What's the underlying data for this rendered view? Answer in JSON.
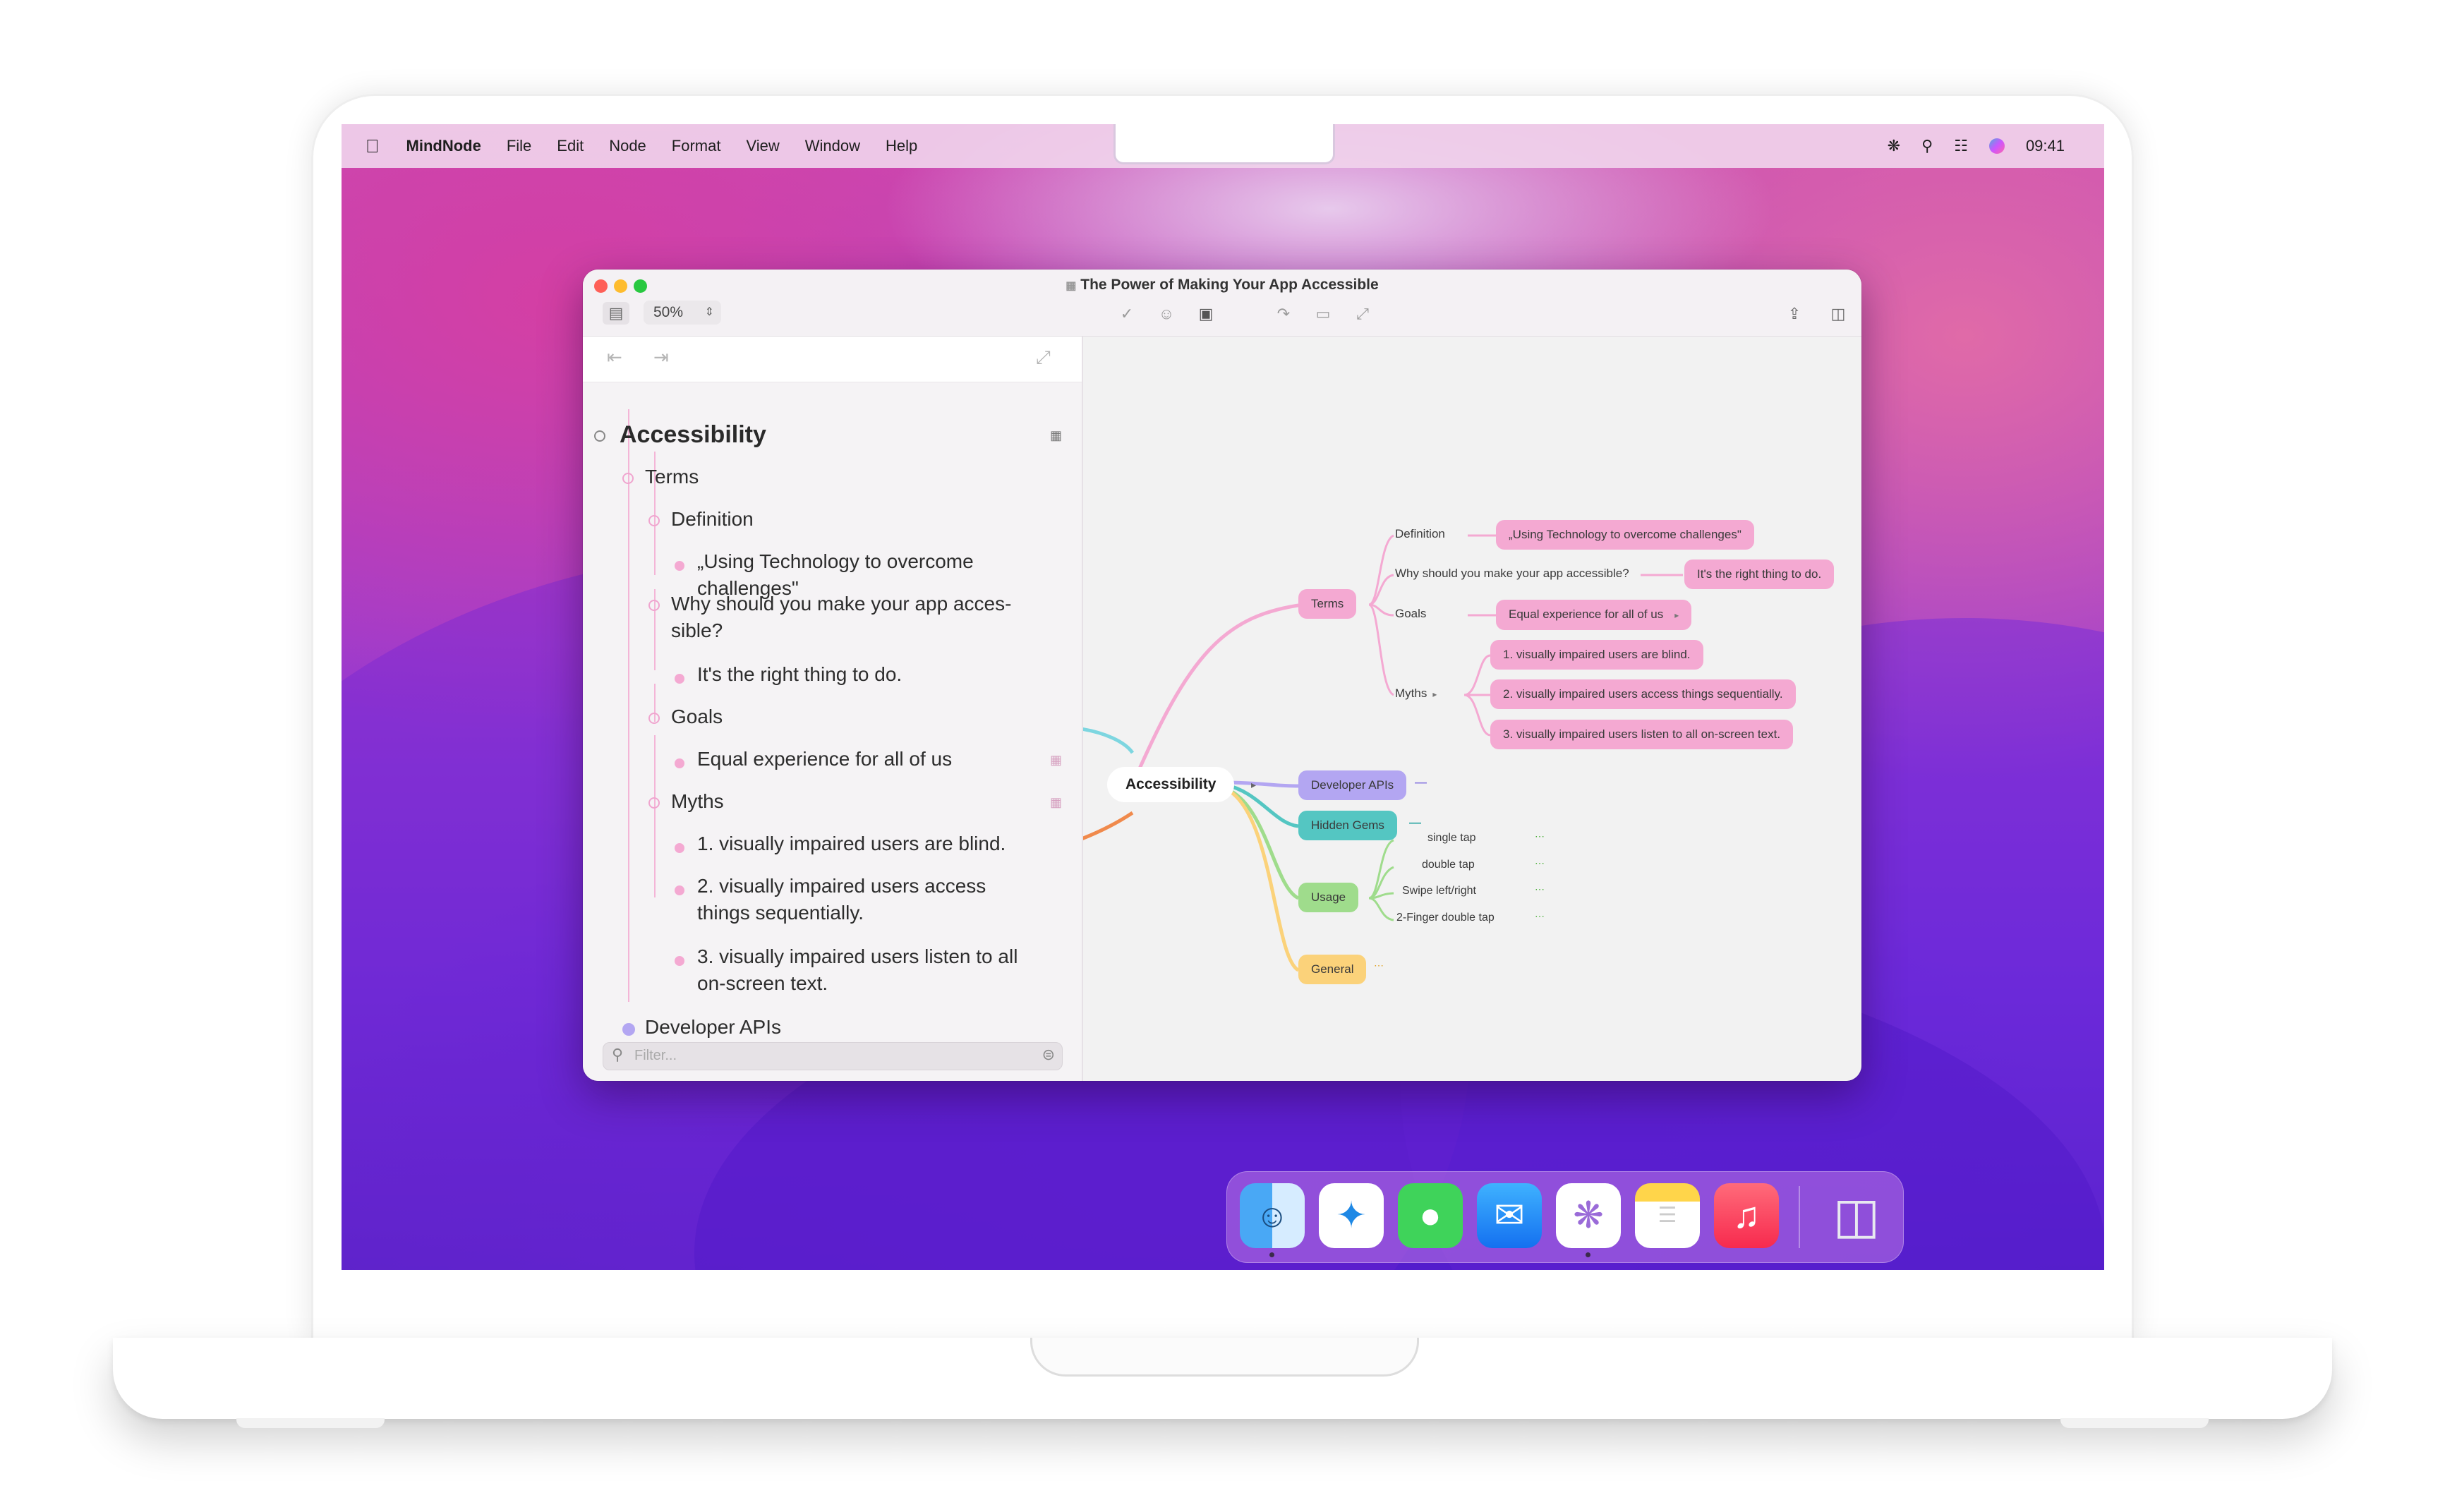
{
  "menubar": {
    "app_name": "MindNode",
    "menus": [
      "File",
      "Edit",
      "Node",
      "Format",
      "View",
      "Window",
      "Help"
    ],
    "clock": "09:41"
  },
  "window": {
    "title": "The Power of Making Your App Accessible",
    "zoom": "50%"
  },
  "outline": {
    "root": "Accessibility",
    "terms": "Terms",
    "definition": "Definition",
    "definition_value_1": "„Using Technology to overcome",
    "definition_value_2": "challenges\"",
    "why_1": "Why should you make your app acces-",
    "why_2": "sible?",
    "why_value": "It's the right thing to do.",
    "goals": "Goals",
    "goals_value": "Equal experience for all of us",
    "myths": "Myths",
    "myth_1": "1. visually impaired users are blind.",
    "myth_2_a": "2. visually impaired users access",
    "myth_2_b": "things sequentially.",
    "myth_3_a": "3. visually impaired users listen to all",
    "myth_3_b": "on-screen text.",
    "developer_apis": "Developer APIs",
    "filter_placeholder": "Filter..."
  },
  "mindmap": {
    "root": "Accessibility",
    "terms": "Terms",
    "definition": "Definition",
    "definition_value": "„Using Technology to overcome challenges\"",
    "why": "Why should you make your app accessible?",
    "why_value": "It's the right thing to do.",
    "goals": "Goals",
    "goals_value": "Equal experience for all of us",
    "myths": "Myths",
    "myth_1": "1. visually impaired users are blind.",
    "myth_2": "2. visually impaired users access things sequentially.",
    "myth_3": "3. visually impaired users listen to all on-screen text.",
    "developer_apis": "Developer APIs",
    "hidden_gems": "Hidden Gems",
    "usage": "Usage",
    "usage_items": [
      "single tap",
      "double tap",
      "Swipe left/right",
      "2-Finger double tap"
    ],
    "general": "General"
  },
  "colors": {
    "pink": "#f4a9d2",
    "purple": "#b3a6f2",
    "teal": "#54c6c2",
    "green": "#9fdc8c",
    "yellow": "#fbd27a",
    "orange": "#f08a4c"
  },
  "dock": {
    "apps": [
      "finder-icon",
      "safari-icon",
      "messages-icon",
      "mail-icon",
      "mindnode-icon",
      "notes-icon",
      "music-icon",
      "trash-icon"
    ]
  }
}
